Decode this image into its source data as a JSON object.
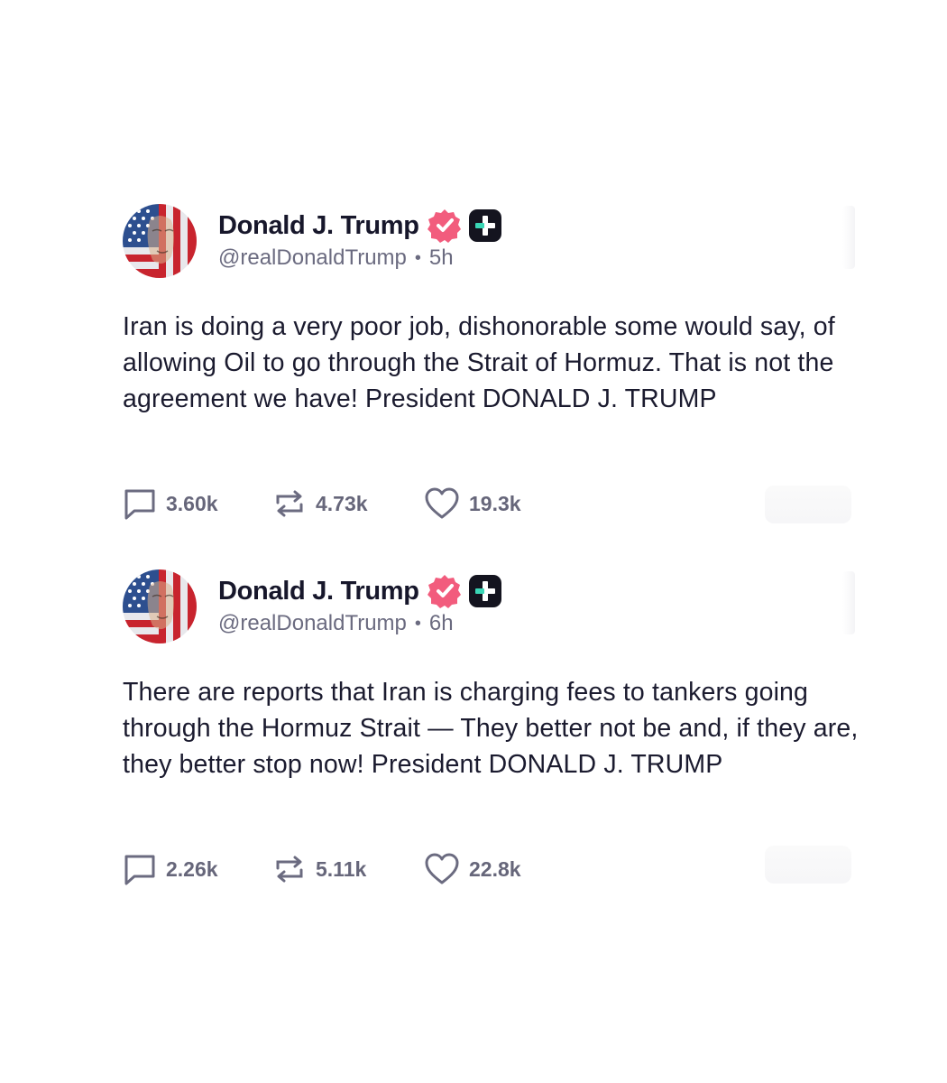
{
  "posts": [
    {
      "author": {
        "display_name": "Donald J. Trump",
        "handle": "@realDonaldTrump",
        "avatar_icon": "flag-portrait-avatar",
        "verified_icon": "verified-badge-icon",
        "verified_color": "#f25c7d",
        "plus_icon": "plus-badge-icon"
      },
      "separator": "•",
      "time": "5h",
      "text": "Iran is doing a very poor job, dishonorable some would say, of allowing Oil to go through the Strait of Hormuz. That is not the agreement we have! President DONALD J. TRUMP",
      "stats": {
        "replies": "3.60k",
        "reposts": "4.73k",
        "likes": "19.3k"
      }
    },
    {
      "author": {
        "display_name": "Donald J. Trump",
        "handle": "@realDonaldTrump",
        "avatar_icon": "flag-portrait-avatar",
        "verified_icon": "verified-badge-icon",
        "verified_color": "#f25c7d",
        "plus_icon": "plus-badge-icon"
      },
      "separator": "•",
      "time": "6h",
      "text": "There are reports that Iran is charging fees to tankers going through the Hormuz Strait — They better not be and, if they are, they better stop now! President DONALD J. TRUMP",
      "stats": {
        "replies": "2.26k",
        "reposts": "5.11k",
        "likes": "22.8k"
      }
    }
  ]
}
